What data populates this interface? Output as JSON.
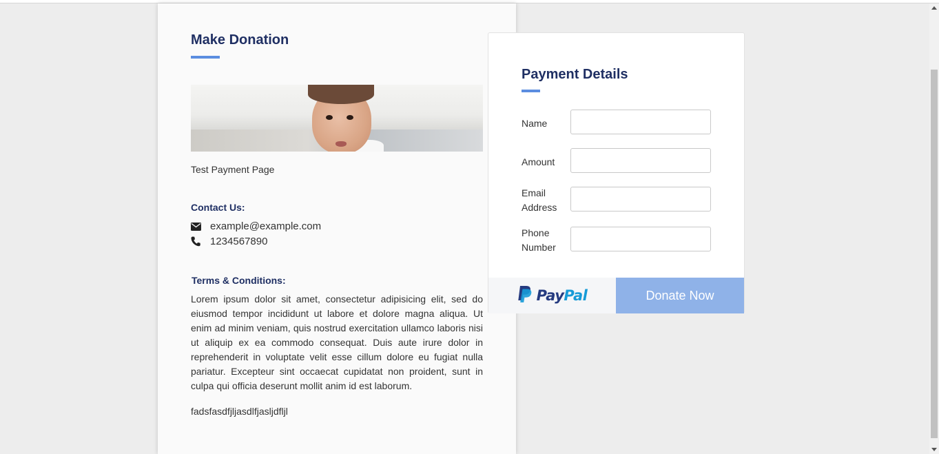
{
  "donation": {
    "title": "Make Donation",
    "description": "Test Payment Page",
    "contact_title": "Contact Us:",
    "email": "example@example.com",
    "phone": "1234567890",
    "terms_title": "Terms & Conditions:",
    "terms_text": "Lorem ipsum dolor sit amet, consectetur adipisicing elit, sed do eiusmod tempor incididunt ut labore et dolore magna aliqua. Ut enim ad minim veniam, quis nostrud exercitation ullamco laboris nisi ut aliquip ex ea commodo consequat. Duis aute irure dolor in reprehenderit in voluptate velit esse cillum dolore eu fugiat nulla pariatur. Excepteur sint occaecat cupidatat non proident, sunt in culpa qui officia deserunt mollit anim id est laborum.",
    "extra_text": "fadsfasdfjljasdlfjasljdfljl"
  },
  "payment": {
    "title": "Payment Details",
    "fields": [
      {
        "label": "Name",
        "value": "",
        "placeholder": ""
      },
      {
        "label": "Amount",
        "value": "",
        "placeholder": ""
      },
      {
        "label": "Email Address",
        "value": "",
        "placeholder": ""
      },
      {
        "label": "Phone Number",
        "value": "",
        "placeholder": ""
      }
    ],
    "paypal_pay": "Pay",
    "paypal_pal": "Pal",
    "donate_label": "Donate Now"
  },
  "colors": {
    "title": "#1f2f63",
    "accent": "#5b8de0",
    "donate_button": "#8fb2e8",
    "paypal_dark": "#253b80",
    "paypal_light": "#179bd7"
  },
  "icons": {
    "email": "envelope-icon",
    "phone": "phone-icon",
    "paypal": "paypal-logo-icon"
  }
}
